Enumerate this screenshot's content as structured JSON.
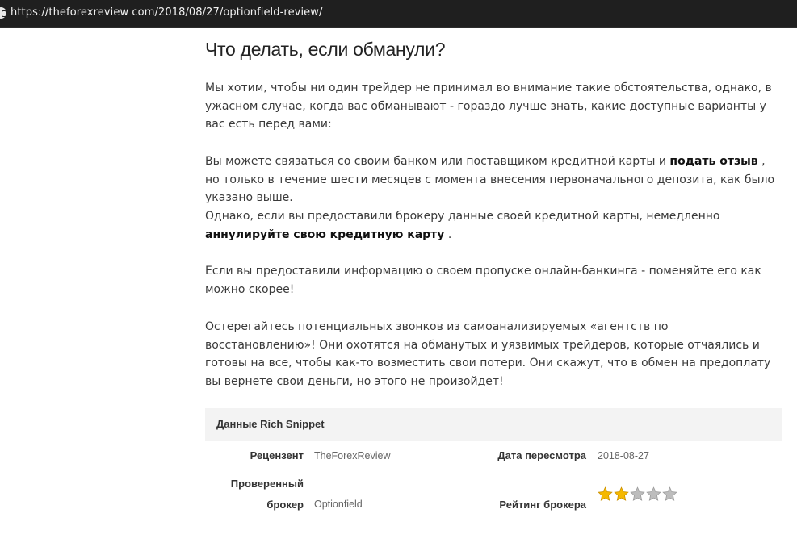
{
  "browser": {
    "url": "https://theforexreview com/2018/08/27/optionfield-review/"
  },
  "article": {
    "heading": "Что делать, если обманули?",
    "p1": "Мы хотим, чтобы ни один трейдер не принимал во внимание такие обстоятельства, однако, в ужасном случае, когда вас обманывают - гораздо лучше знать, какие доступные варианты у вас есть перед вами:",
    "p2": {
      "before": "Вы можете связаться со своим банком или поставщиком кредитной карты и ",
      "bold": "подать отзыв",
      "after": " , но только в течение шести месяцев с момента внесения первоначального депозита, как было указано выше."
    },
    "p3": {
      "before": "Однако, если вы предоставили брокеру данные своей кредитной карты, немедленно ",
      "bold": "аннулируйте свою кредитную карту",
      "after": " ."
    },
    "p4": "Если вы предоставили информацию о своем пропуске онлайн-банкинга - поменяйте его как можно скорее!",
    "p5": "Остерегайтесь потенциальных звонков из самоанализируемых «агентств по восстановлению»! Они охотятся на обманутых и уязвимых трейдеров, которые отчаялись и готовы на все, чтобы как-то возместить свои потери. Они скажут, что в обмен на предоплату вы вернете свои деньги, но этого не произойдет!"
  },
  "snippet": {
    "title": "Данные Rich Snippet",
    "reviewer_label": "Рецензент",
    "reviewer_value": "TheForexReview",
    "date_label": "Дата пересмотра",
    "date_value": "2018-08-27",
    "broker_label_line1": "Проверенный",
    "broker_label_line2": "брокер",
    "broker_value": "Optionfield",
    "rating_label": "Рейтинг брокера",
    "rating": {
      "value": 2,
      "max": 5
    },
    "colors": {
      "star_filled": "#f5b800",
      "star_empty": "#bdbdbd"
    }
  }
}
